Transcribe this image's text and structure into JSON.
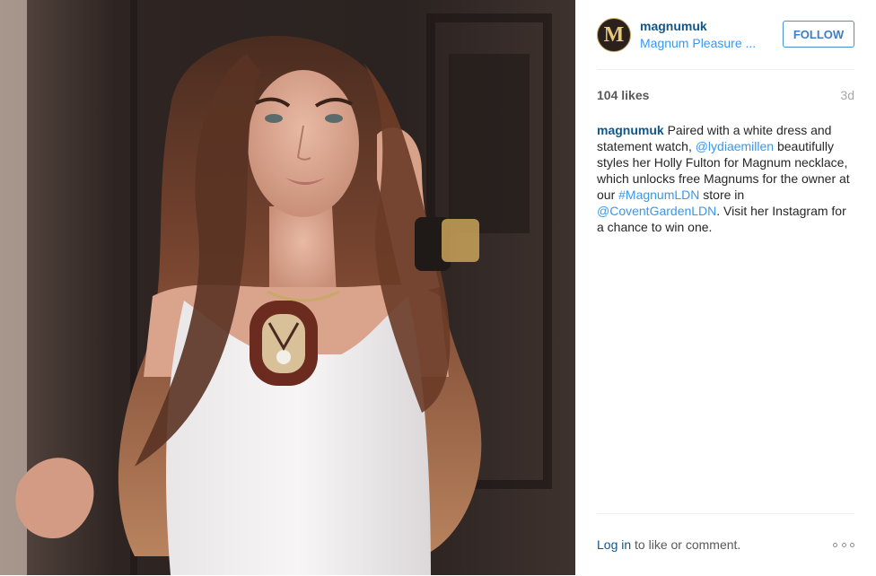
{
  "post": {
    "image": {
      "icon": "post-photo-woman-with-necklace"
    },
    "author": {
      "username": "magnumuk",
      "location": "Magnum Pleasure ...",
      "avatar_letter": "M",
      "avatar_colors": {
        "background": "#2a211d",
        "letter": "#e7c77f"
      }
    },
    "follow_label": "FOLLOW",
    "likes": "104 likes",
    "time_ago": "3d",
    "caption": {
      "author": "magnumuk",
      "t1": " Paired with a white dress and statement watch, ",
      "mention1": "@lydiaemillen",
      "t2": " beautifully styles her Holly Fulton for Magnum necklace, which unlocks free Magnums for the owner at our ",
      "hashtag": "#MagnumLDN",
      "t3": " store in ",
      "mention2": "@CoventGardenLDN",
      "t4": ". Visit her Instagram for a chance to win one."
    },
    "footer": {
      "login_label": "Log in",
      "rest": " to like or comment.",
      "more_icon": "more-options-icon"
    },
    "colors": {
      "username": "#125688",
      "link": "#3897f0",
      "follow_border": "#4a8fd0",
      "muted": "#a5a7aa"
    }
  }
}
